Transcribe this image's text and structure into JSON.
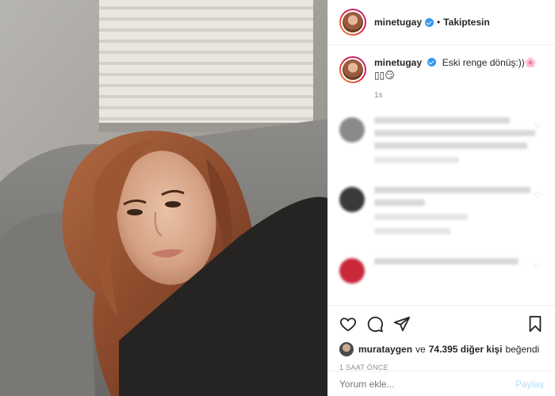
{
  "header": {
    "username": "minetugay",
    "separator": "•",
    "follow_label": "Takiptesin"
  },
  "caption": {
    "username": "minetugay",
    "text": "Eski renge dönüş:))🌸",
    "emoji_line": "▯▯😏",
    "time": "1s"
  },
  "actions": {
    "icons": [
      "heart-icon",
      "comment-icon",
      "share-icon",
      "bookmark-icon"
    ]
  },
  "likes": {
    "first_user": "murataygen",
    "connector": "ve",
    "count_text": "74.395 diğer kişi",
    "suffix": "beğendi"
  },
  "timestamp": "1 SAAT ÖNCE",
  "comment_box": {
    "placeholder": "Yorum ekle...",
    "post_label": "Paylaş"
  },
  "colors": {
    "verified": "#3897f0",
    "border": "#efefef",
    "muted": "#8e8e8e",
    "post_button": "#b2dffc"
  }
}
